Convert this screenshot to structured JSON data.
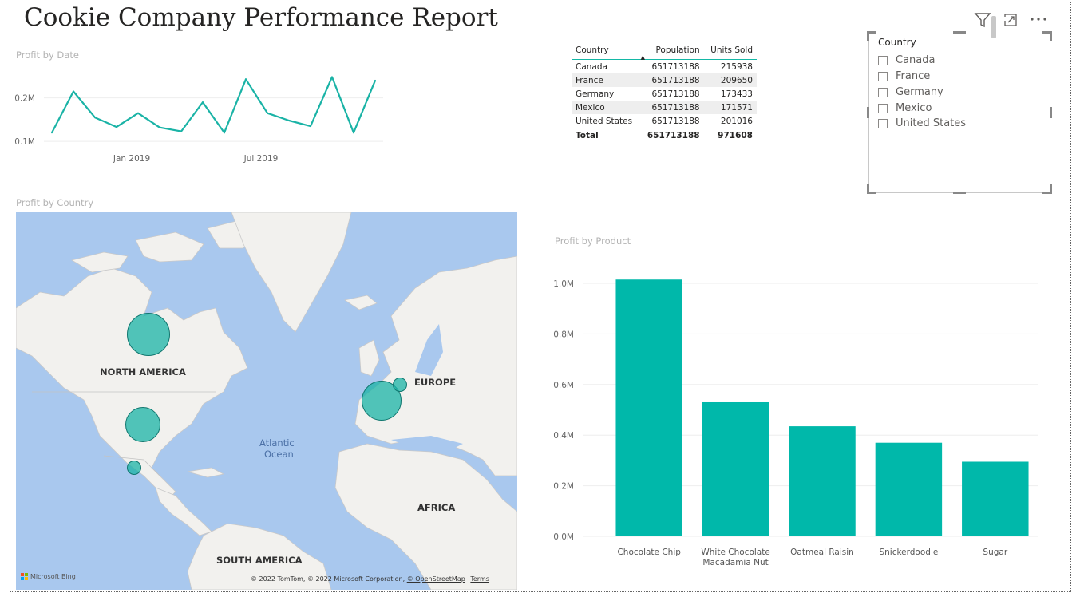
{
  "report": {
    "title": "Cookie Company Performance Report"
  },
  "toolbar": {
    "filter_icon": "filter-icon",
    "focus_icon": "focus-mode-icon",
    "more_icon": "more-options-icon"
  },
  "profit_by_date": {
    "title": "Profit by Date",
    "chart_data": {
      "type": "line",
      "title": "Profit by Date",
      "x_ticks": [
        "Jan 2019",
        "Jul 2019"
      ],
      "y_ticks": [
        "0.1M",
        "0.2M"
      ],
      "x": [
        "2018-09",
        "2018-10",
        "2018-11",
        "2018-12",
        "2019-01",
        "2019-02",
        "2019-03",
        "2019-04",
        "2019-05",
        "2019-06",
        "2019-07",
        "2019-08",
        "2019-09",
        "2019-10",
        "2019-11",
        "2019-12"
      ],
      "values": [
        0.12,
        0.215,
        0.155,
        0.133,
        0.165,
        0.132,
        0.123,
        0.19,
        0.12,
        0.243,
        0.165,
        0.148,
        0.135,
        0.248,
        0.12,
        0.24
      ],
      "ylim": [
        0.08,
        0.26
      ],
      "color": "#1ab3a6",
      "grid": true
    }
  },
  "table": {
    "headers": [
      "Country",
      "Population",
      "Units Sold"
    ],
    "rows": [
      [
        "Canada",
        "651713188",
        "215938"
      ],
      [
        "France",
        "651713188",
        "209650"
      ],
      [
        "Germany",
        "651713188",
        "173433"
      ],
      [
        "Mexico",
        "651713188",
        "171571"
      ],
      [
        "United States",
        "651713188",
        "201016"
      ]
    ],
    "total": [
      "Total",
      "651713188",
      "971608"
    ]
  },
  "slicer": {
    "header": "Country",
    "items": [
      "Canada",
      "France",
      "Germany",
      "Mexico",
      "United States"
    ]
  },
  "profit_by_country": {
    "title": "Profit by Country",
    "labels": {
      "north_america": "NORTH AMERICA",
      "europe": "EUROPE",
      "atlantic1": "Atlantic",
      "atlantic2": "Ocean",
      "africa": "AFRICA",
      "south_america": "SOUTH AMERICA"
    },
    "attribution": "© 2022 TomTom, © 2022 Microsoft Corporation,",
    "osm_link": "© OpenStreetMap",
    "terms_link": "Terms",
    "logo": "Microsoft Bing"
  },
  "profit_by_product": {
    "title": "Profit by Product",
    "chart_data": {
      "type": "bar",
      "title": "Profit by Product",
      "categories": [
        "Chocolate Chip",
        "White Chocolate Macadamia Nut",
        "Oatmeal Raisin",
        "Snickerdoodle",
        "Sugar"
      ],
      "category_lines": [
        [
          "Chocolate Chip"
        ],
        [
          "White Chocolate",
          "Macadamia Nut"
        ],
        [
          "Oatmeal Raisin"
        ],
        [
          "Snickerdoodle"
        ],
        [
          "Sugar"
        ]
      ],
      "values": [
        1.015,
        0.53,
        0.435,
        0.37,
        0.295
      ],
      "y_ticks": [
        "0.0M",
        "0.2M",
        "0.4M",
        "0.6M",
        "0.8M",
        "1.0M"
      ],
      "ylim": [
        0,
        1.0
      ],
      "color": "#00b8aa",
      "grid": true
    }
  }
}
